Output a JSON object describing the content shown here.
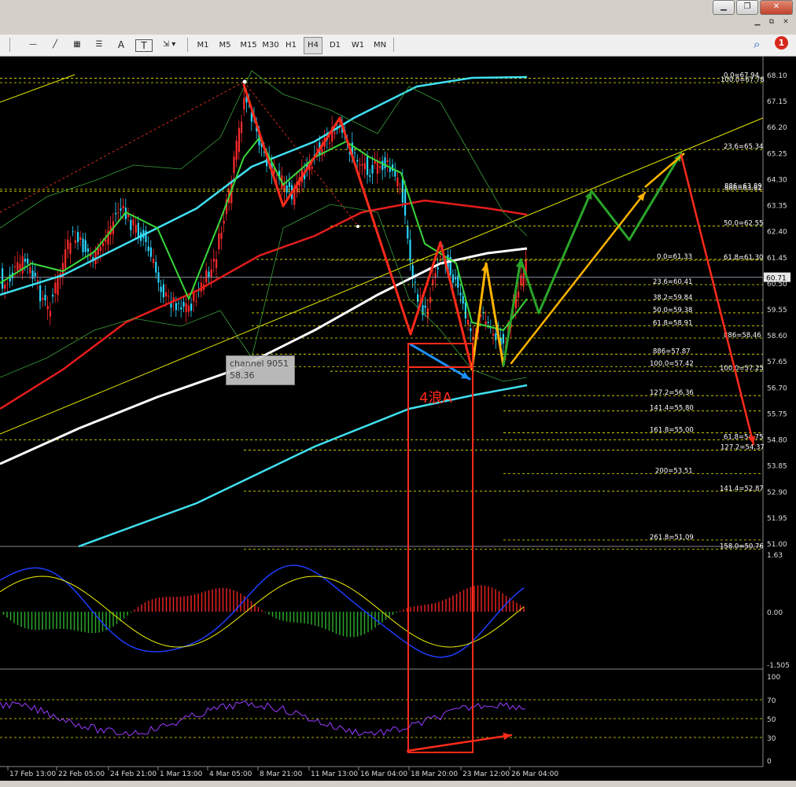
{
  "window": {
    "buttons": [
      {
        "name": "minimize",
        "glyph": "▁"
      },
      {
        "name": "restore",
        "glyph": "❐"
      },
      {
        "name": "close",
        "glyph": "✕"
      }
    ],
    "child_buttons": [
      "▁",
      "⧉",
      "✕"
    ]
  },
  "toolbar": {
    "timeframes": [
      "M1",
      "M5",
      "M15",
      "M30",
      "H1",
      "H4",
      "D1",
      "W1",
      "MN"
    ],
    "active_timeframe": "H4",
    "text_tool": "A",
    "label_tool": "T",
    "notification_count": "1"
  },
  "price_axis": {
    "labels": [
      "68.10",
      "67.15",
      "66.20",
      "65.25",
      "64.30",
      "63.35",
      "62.40",
      "61.45",
      "60.50",
      "59.55",
      "58.60",
      "57.65",
      "56.70",
      "55.75",
      "54.80",
      "53.85",
      "52.90",
      "51.95",
      "51.00"
    ],
    "current_price": "60.71"
  },
  "fib_labels": [
    {
      "text": "0.0=67.94"
    },
    {
      "text": "100.0=67.78"
    },
    {
      "text": "23.6=65.34"
    },
    {
      "text": "886=63.89"
    },
    {
      "text": "886=63.82"
    },
    {
      "text": "50.0=62.55"
    },
    {
      "text": "0.0=61.33"
    },
    {
      "text": "61.8=61.30"
    },
    {
      "text": "23.6=60.41"
    },
    {
      "text": "38.2=59.84"
    },
    {
      "text": "50.0=59.38"
    },
    {
      "text": "61.8=58.91"
    },
    {
      "text": "886=58.46"
    },
    {
      "text": "886=57.87"
    },
    {
      "text": "100.0=57.42"
    },
    {
      "text": "100.0=57.25"
    },
    {
      "text": "127.2=56.36"
    },
    {
      "text": "141.4=55.80"
    },
    {
      "text": "161.8=55.00"
    },
    {
      "text": "61.8=54.75"
    },
    {
      "text": "127.2=54.37"
    },
    {
      "text": "200=53.51"
    },
    {
      "text": "141.4=52.87"
    },
    {
      "text": "261.8=51.09"
    },
    {
      "text": "158.0=50.76"
    }
  ],
  "macd_axis": [
    "1.63",
    "0.00",
    "-1.505"
  ],
  "rsi_axis": [
    "100",
    "70",
    "50",
    "30",
    "0"
  ],
  "time_axis": [
    "17 Feb 13:00",
    "22 Feb 05:00",
    "24 Feb 21:00",
    "1 Mar 13:00",
    "4 Mar 05:00",
    "8 Mar 21:00",
    "11 Mar 13:00",
    "16 Mar 04:00",
    "18 Mar 20:00",
    "23 Mar 12:00",
    "26 Mar 04:00"
  ],
  "tooltip": {
    "line1": "channel 9051",
    "line2": "58.36"
  },
  "annotation": "4浪A",
  "colors": {
    "bull": "#ff2a2a",
    "bear": "#28d7ff",
    "accent_red": "#ff2b1a",
    "orange": "#ffb400",
    "green": "#2aa52a",
    "blue_arrow": "#1e90ff",
    "fib": "#e6e600"
  }
}
